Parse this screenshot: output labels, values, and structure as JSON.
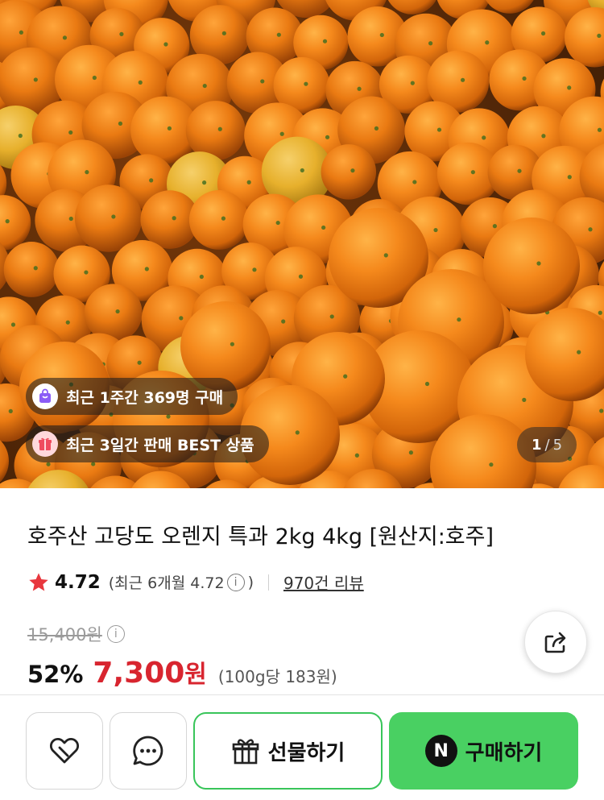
{
  "gallery": {
    "badges": [
      {
        "icon": "shopping-bag-icon",
        "text": "최근 1주간 369명 구매"
      },
      {
        "icon": "gift-box-icon",
        "text": "최근 3일간 판매 BEST 상품"
      }
    ],
    "counter": {
      "current": "1",
      "separator": "/",
      "total": "5"
    }
  },
  "product": {
    "title": "호주산 고당도 오렌지 특과 2kg 4kg [원산지:호주]",
    "rating": {
      "score": "4.72",
      "recent_open": "(최근 6개월 4.72",
      "recent_close": ")",
      "info_glyph": "i",
      "reviews": "970건 리뷰"
    },
    "price": {
      "original": "15,400원",
      "discount": "52%",
      "sale_amount": "7,300",
      "currency": "원",
      "unit_price": "(100g당 183원)"
    }
  },
  "actions": {
    "gift_label": "선물하기",
    "buy_label": "구매하기",
    "npay_glyph": "N"
  },
  "colors": {
    "sale_red": "#d8252f",
    "buy_green": "#49d062",
    "gift_border_green": "#39c55a",
    "star": "#e8373e"
  }
}
